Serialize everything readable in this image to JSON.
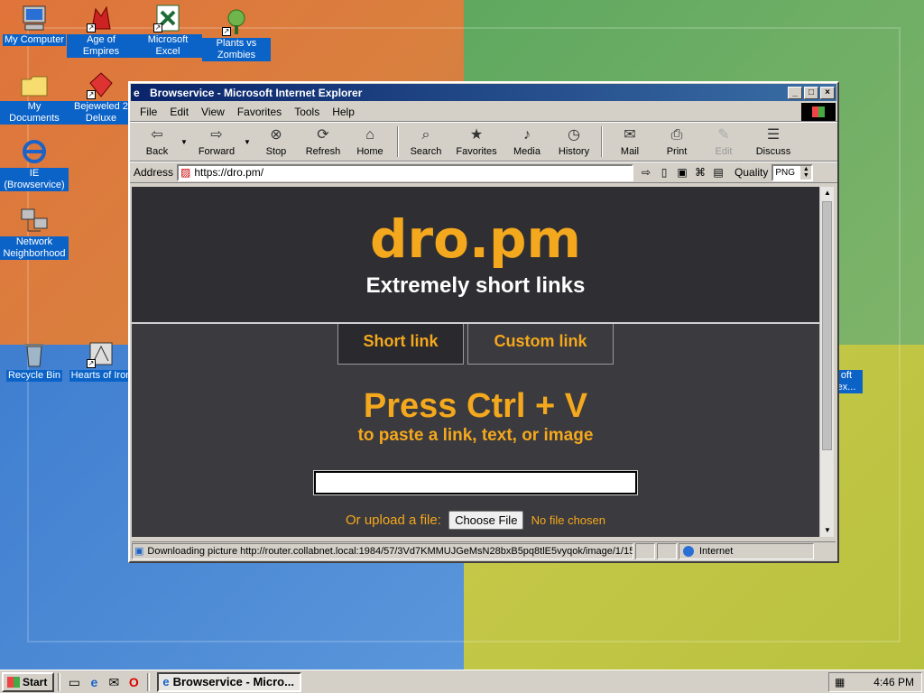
{
  "desktop": {
    "icons": [
      {
        "label": "My Computer",
        "icon": "computer-icon"
      },
      {
        "label": "Age of Empires",
        "icon": "game-icon"
      },
      {
        "label": "Microsoft Excel",
        "icon": "excel-icon"
      },
      {
        "label": "Plants vs Zombies",
        "icon": "game-icon"
      },
      {
        "label": "My Documents",
        "icon": "folder-icon"
      },
      {
        "label": "Bejeweled 2 Deluxe",
        "icon": "game-icon"
      },
      {
        "label": "IE (Browservice)",
        "icon": "ie-icon"
      },
      {
        "label": "Network Neighborhood",
        "icon": "network-icon"
      },
      {
        "label": "Recycle Bin",
        "icon": "recycle-bin-icon"
      },
      {
        "label": "Hearts of Iron",
        "icon": "game-icon"
      },
      {
        "label": "oft ex...",
        "icon": "app-icon"
      }
    ]
  },
  "window": {
    "title": "Browservice - Microsoft Internet Explorer",
    "menu": [
      "File",
      "Edit",
      "View",
      "Favorites",
      "Tools",
      "Help"
    ],
    "toolbar": [
      {
        "label": "Back",
        "icon": "back-arrow-icon"
      },
      {
        "label": "Forward",
        "icon": "forward-arrow-icon"
      },
      {
        "label": "Stop",
        "icon": "stop-icon"
      },
      {
        "label": "Refresh",
        "icon": "refresh-icon"
      },
      {
        "label": "Home",
        "icon": "home-icon"
      },
      {
        "label": "Search",
        "icon": "search-icon"
      },
      {
        "label": "Favorites",
        "icon": "favorites-icon"
      },
      {
        "label": "Media",
        "icon": "media-icon"
      },
      {
        "label": "History",
        "icon": "history-icon"
      },
      {
        "label": "Mail",
        "icon": "mail-icon"
      },
      {
        "label": "Print",
        "icon": "print-icon"
      },
      {
        "label": "Edit",
        "icon": "edit-icon"
      },
      {
        "label": "Discuss",
        "icon": "discuss-icon"
      }
    ],
    "address_label": "Address",
    "address_value": "https://dro.pm/",
    "quality_label": "Quality",
    "quality_value": "PNG",
    "status_text": "Downloading picture http://router.collabnet.local:1984/57/3Vd7KMMUJGeMsN28bxB5pq8tlE5vyqok/image/1/15",
    "status_zone": "Internet"
  },
  "page": {
    "logo": "dro.pm",
    "tagline": "Extremely short links",
    "tabs": [
      "Short link",
      "Custom link"
    ],
    "press_title": "Press Ctrl + V",
    "press_sub": "to paste a link, text, or image",
    "paste_value": "",
    "upload_label": "Or upload a file:",
    "choose_file": "Choose File",
    "no_file": "No file chosen",
    "accent": "#f4a81d",
    "background": "#3b3a3e"
  },
  "taskbar": {
    "start_label": "Start",
    "task_label": "Browservice - Micro...",
    "clock": "4:46 PM"
  }
}
